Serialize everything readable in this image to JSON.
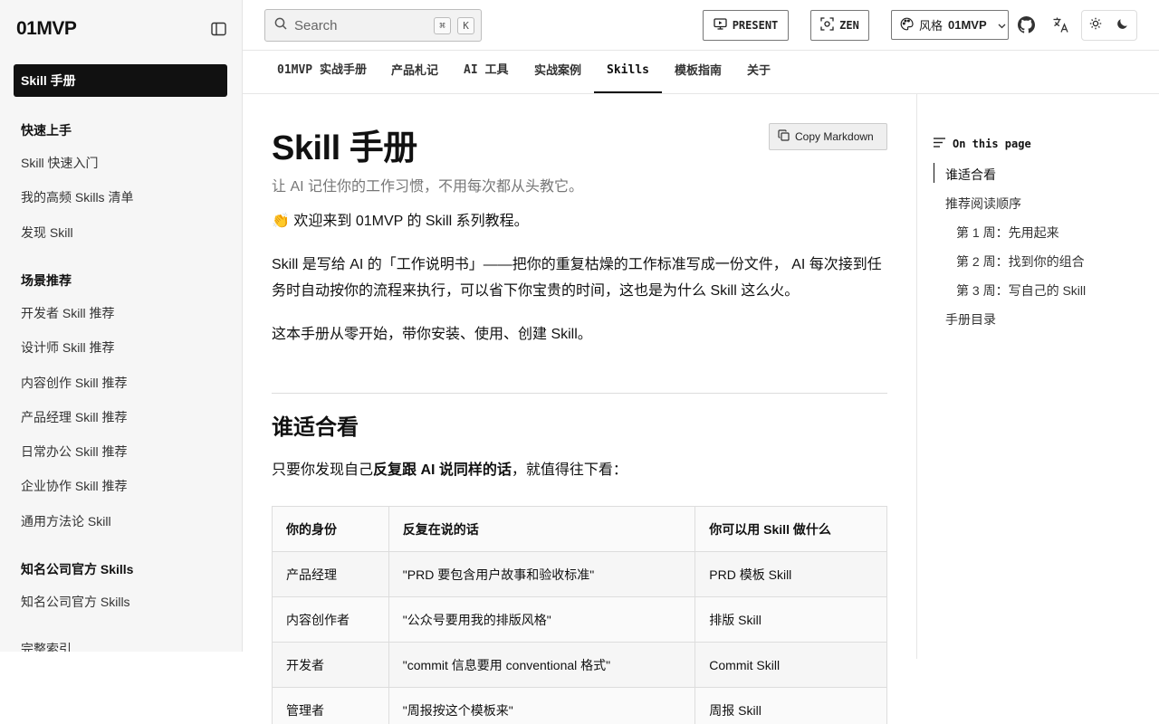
{
  "brand": {
    "logo": "01MVP"
  },
  "sidebar": {
    "active": "Skill 手册",
    "groups": [
      {
        "title": "快速上手",
        "items": [
          "Skill 快速入门",
          "我的高频 Skills 清单",
          "发现 Skill"
        ]
      },
      {
        "title": "场景推荐",
        "items": [
          "开发者 Skill 推荐",
          "设计师 Skill 推荐",
          "内容创作 Skill 推荐",
          "产品经理 Skill 推荐",
          "日常办公 Skill 推荐",
          "企业协作 Skill 推荐",
          "通用方法论 Skill"
        ]
      },
      {
        "title": "知名公司官方 Skills",
        "items": [
          "知名公司官方 Skills",
          "完整索引"
        ]
      }
    ]
  },
  "header": {
    "search_placeholder": "Search",
    "kbd_cmd": "⌘",
    "kbd_k": "K",
    "present_label": "PRESENT",
    "zen_label": "ZEN",
    "style_prefix": "风格",
    "style_value": "01MVP"
  },
  "tabs": [
    "01MVP 实战手册",
    "产品札记",
    "AI 工具",
    "实战案例",
    "Skills",
    "模板指南",
    "关于"
  ],
  "main": {
    "title": "Skill 手册",
    "copy_label": "Copy Markdown",
    "subtitle": "让 AI 记住你的工作习惯，不用每次都从头教它。",
    "welcome": "👏 欢迎来到 01MVP 的 Skill 系列教程。",
    "para1": "Skill 是写给 AI 的「工作说明书」——把你的重复枯燥的工作标准写成一份文件， AI 每次接到任务时自动按你的流程来执行，可以省下你宝贵的时间，这也是为什么 Skill 这么火。",
    "para2": "这本手册从零开始，带你安装、使用、创建 Skill。",
    "section_title": "谁适合看",
    "section_intro_pre": "只要你发现自己",
    "section_intro_bold": "反复跟 AI 说同样的话",
    "section_intro_post": "，就值得往下看：",
    "table": {
      "headers": [
        "你的身份",
        "反复在说的话",
        "你可以用 Skill 做什么"
      ],
      "rows": [
        [
          "产品经理",
          "\"PRD 要包含用户故事和验收标准\"",
          "PRD 模板 Skill"
        ],
        [
          "内容创作者",
          "\"公众号要用我的排版风格\"",
          "排版 Skill"
        ],
        [
          "开发者",
          "\"commit 信息要用 conventional 格式\"",
          "Commit Skill"
        ],
        [
          "管理者",
          "\"周报按这个模板来\"",
          "周报 Skill"
        ]
      ]
    }
  },
  "toc": {
    "title": "On this page",
    "items": [
      "谁适合看",
      "推荐阅读顺序",
      "第 1 周：先用起来",
      "第 2 周：找到你的组合",
      "第 3 周：写自己的 Skill",
      "手册目录"
    ]
  }
}
